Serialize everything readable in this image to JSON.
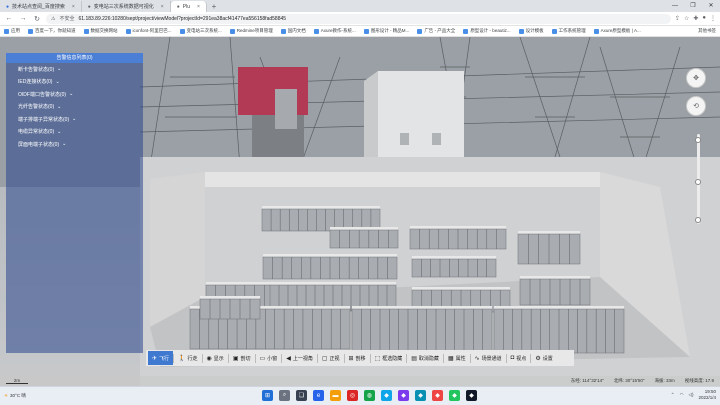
{
  "browser": {
    "tabs": [
      {
        "title": "技术站点查阅_百度搜索",
        "active": false
      },
      {
        "title": "变电站三次系统数据可视化",
        "active": false
      },
      {
        "title": "Plu",
        "active": true
      }
    ],
    "new_tab": "+",
    "url_warning": "不安全",
    "url": "61.183.89.226:10280/sept/project/viewModel?projectId=291ea38acf41477ea556158fad58845",
    "bookmarks": [
      "应用",
      "百度一下，你就知道",
      "数据交换网站",
      "iconfont-阿里巴巴...",
      "变电站三次系统...",
      "Redmine项目管理",
      "国内文档",
      "Axure教作-系统...",
      "图形设计 - 精品M...",
      "广告 - 产品大全",
      "原型设计 - beautiz...",
      "设计模板",
      "工作系统管理",
      "Axure原型模板 | A..."
    ],
    "bookmarks_right": "其他书签"
  },
  "alarm_panel": {
    "title": "告警信息列表(0)",
    "items": [
      "断卡告警状态(0)",
      "IED连接状态(0)",
      "OIDF端口告警状态(0)",
      "光纤告警状态(0)",
      "端子排端子异常状态(0)",
      "电缆异常状态(0)",
      "屏面电端子状态(0)"
    ]
  },
  "toolbar": {
    "items": [
      {
        "label": "飞行",
        "icon": "plane-icon",
        "glyph": "✈",
        "active": true
      },
      {
        "label": "行走",
        "icon": "walk-icon",
        "glyph": "🚶",
        "active": false
      },
      {
        "label": "显示",
        "icon": "eye-icon",
        "glyph": "◉",
        "active": false
      },
      {
        "label": "剖切",
        "icon": "cut-icon",
        "glyph": "▣",
        "active": false
      },
      {
        "label": "小窗",
        "icon": "window-icon",
        "glyph": "▭",
        "active": false
      },
      {
        "label": "上一视角",
        "icon": "back-view-icon",
        "glyph": "◀",
        "active": false
      },
      {
        "label": "正视",
        "icon": "front-view-icon",
        "glyph": "▢",
        "active": false
      },
      {
        "label": "剖移",
        "icon": "section-move-icon",
        "glyph": "⊞",
        "active": false
      },
      {
        "label": "框选隐藏",
        "icon": "box-hide-icon",
        "glyph": "⬚",
        "active": false
      },
      {
        "label": "取消隐藏",
        "icon": "unhide-icon",
        "glyph": "▤",
        "active": false
      },
      {
        "label": "属性",
        "icon": "property-icon",
        "glyph": "▦",
        "active": false
      },
      {
        "label": "场景通道",
        "icon": "scene-channel-icon",
        "glyph": "∿",
        "active": false
      },
      {
        "label": "视点",
        "icon": "camera-icon",
        "glyph": "◘",
        "active": false
      },
      {
        "label": "设置",
        "icon": "gear-icon",
        "glyph": "⚙",
        "active": false
      }
    ]
  },
  "statusbar": {
    "scale": "2m",
    "longitude": "东经: 114°32'14\"",
    "latitude": "北纬: 30°15'50\"",
    "altitude": "海拔: 33m",
    "view_height": "视线高度: 17.9"
  },
  "taskbar": {
    "weather": "30°C 晴",
    "time": "19:50",
    "date": "2022/1/4"
  }
}
